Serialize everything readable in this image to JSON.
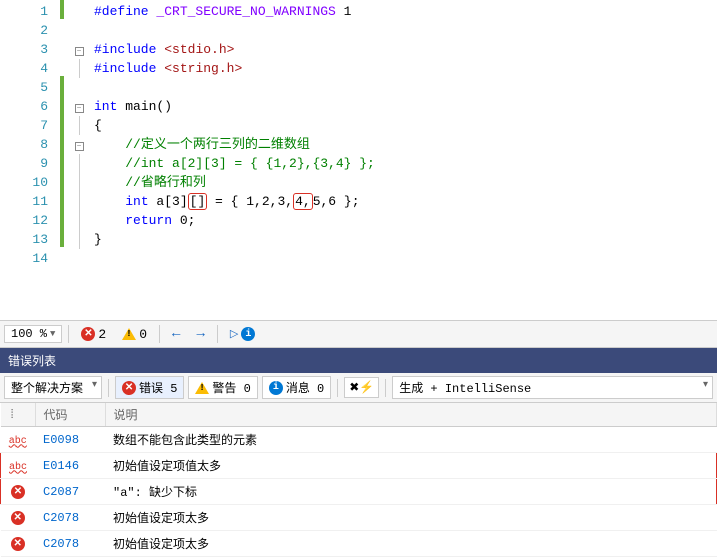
{
  "code": {
    "l1_define": "#define",
    "l1_macro": "_CRT_SECURE_NO_WARNINGS",
    "l1_val": "1",
    "l3_inc": "#include",
    "l3_hdr": "<stdio.h>",
    "l4_inc": "#include",
    "l4_hdr": "<string.h>",
    "l6_int": "int",
    "l6_main": "main()",
    "l7_brace": "{",
    "l8_cmt": "//定义一个两行三列的二维数组",
    "l9_cmt": "//int a[2][3] = { {1,2},{3,4} };",
    "l10_cmt": "//省略行和列",
    "l11_a": "int",
    "l11_b": " a[3]",
    "l11_c": "[]",
    "l11_d": " = { 1,2,3,",
    "l11_e": "4,",
    "l11_f": "5,6 };",
    "l12_ret": "return",
    "l12_val": " 0;",
    "l13_brace": "}"
  },
  "line_numbers": [
    "1",
    "2",
    "3",
    "4",
    "5",
    "6",
    "7",
    "8",
    "9",
    "10",
    "11",
    "12",
    "13",
    "14"
  ],
  "status": {
    "zoom": "100 %",
    "errors": "2",
    "warnings": "0"
  },
  "panel_title": "错误列表",
  "toolbar": {
    "scope": "整个解决方案",
    "err_label": "错误 5",
    "warn_label": "警告 0",
    "info_label": "消息 0",
    "build": "生成 + IntelliSense"
  },
  "columns": {
    "code": "代码",
    "desc": "说明"
  },
  "errors": [
    {
      "icon": "abc",
      "code": "E0098",
      "desc": "数组不能包含此类型的元素",
      "marked": false
    },
    {
      "icon": "abc",
      "code": "E0146",
      "desc": "初始值设定项值太多",
      "marked": true
    },
    {
      "icon": "x",
      "code": "C2087",
      "desc": "\"a\": 缺少下标",
      "marked": true
    },
    {
      "icon": "x",
      "code": "C2078",
      "desc": "初始值设定项太多",
      "marked": false
    },
    {
      "icon": "x",
      "code": "C2078",
      "desc": "初始值设定项太多",
      "marked": false
    }
  ]
}
